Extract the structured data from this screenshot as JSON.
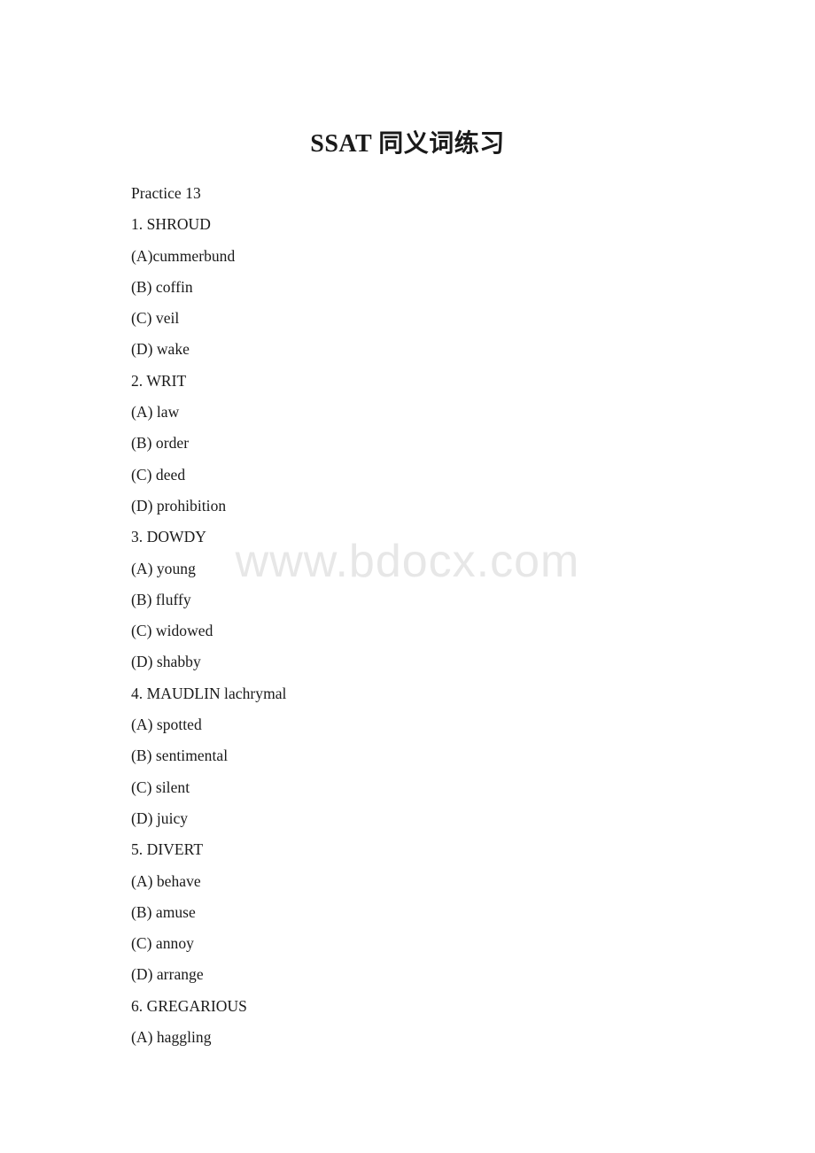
{
  "document": {
    "title": "SSAT 同义词练习",
    "watermark": "www.bdocx.com",
    "section_label": "Practice 13",
    "lines": [
      "Practice 13",
      "1. SHROUD",
      "(A)cummerbund",
      "(B) coffin",
      "(C) veil",
      "(D) wake",
      "2. WRIT",
      "(A) law",
      "(B) order",
      "(C) deed",
      "(D) prohibition",
      "3. DOWDY",
      "(A) young",
      "(B) fluffy",
      "(C) widowed",
      "(D) shabby",
      "4. MAUDLIN lachrymal",
      "(A) spotted",
      "(B) sentimental",
      "(C) silent",
      "(D) juicy",
      "5. DIVERT",
      "(A) behave",
      "(B) amuse",
      "(C) annoy",
      "(D) arrange",
      "6. GREGARIOUS",
      "(A) haggling"
    ],
    "questions": [
      {
        "number": "1",
        "stem": "1. SHROUD",
        "word": "SHROUD",
        "options": [
          "(A)cummerbund",
          "(B) coffin",
          "(C) veil",
          "(D) wake"
        ]
      },
      {
        "number": "2",
        "stem": "2. WRIT",
        "word": "WRIT",
        "options": [
          "(A) law",
          "(B) order",
          "(C) deed",
          "(D) prohibition"
        ]
      },
      {
        "number": "3",
        "stem": "3. DOWDY",
        "word": "DOWDY",
        "options": [
          "(A) young",
          "(B) fluffy",
          "(C) widowed",
          "(D) shabby"
        ]
      },
      {
        "number": "4",
        "stem": "4. MAUDLIN lachrymal",
        "word": "MAUDLIN",
        "note": "lachrymal",
        "options": [
          "(A) spotted",
          "(B) sentimental",
          "(C) silent",
          "(D) juicy"
        ]
      },
      {
        "number": "5",
        "stem": "5. DIVERT",
        "word": "DIVERT",
        "options": [
          "(A) behave",
          "(B) amuse",
          "(C) annoy",
          "(D) arrange"
        ]
      },
      {
        "number": "6",
        "stem": "6. GREGARIOUS",
        "word": "GREGARIOUS",
        "options": [
          "(A) haggling"
        ]
      }
    ],
    "colors": {
      "text": "#1a1a1a",
      "background": "#ffffff",
      "watermark": "#e7e7e7"
    }
  }
}
